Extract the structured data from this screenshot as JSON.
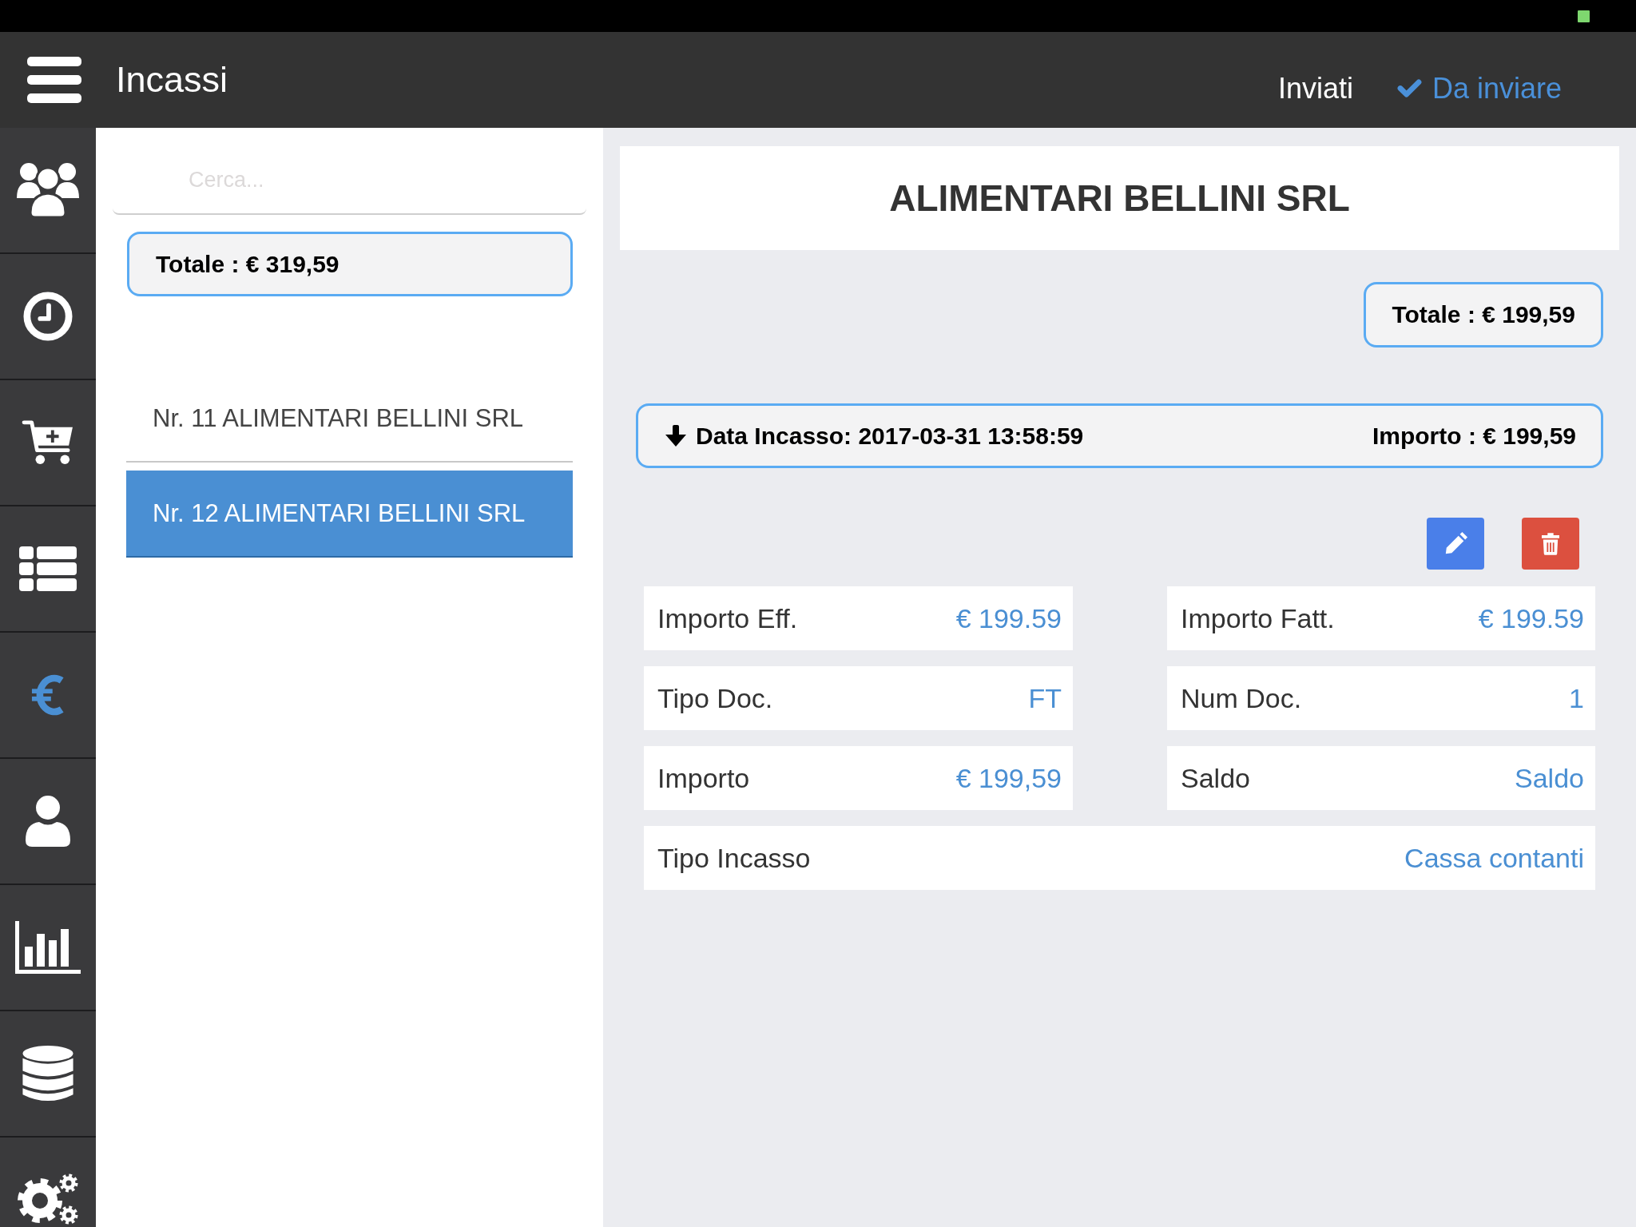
{
  "header": {
    "title": "Incassi",
    "tabs": [
      {
        "label": "Inviati",
        "selected": false
      },
      {
        "label": "Da inviare",
        "selected": true
      }
    ]
  },
  "sidebar": {
    "items": [
      {
        "kind": "users",
        "selected": false
      },
      {
        "kind": "clock",
        "selected": false
      },
      {
        "kind": "cart",
        "selected": false
      },
      {
        "kind": "list",
        "selected": false
      },
      {
        "kind": "euro",
        "selected": true
      },
      {
        "kind": "user",
        "selected": false
      },
      {
        "kind": "chart",
        "selected": false
      },
      {
        "kind": "database",
        "selected": false
      },
      {
        "kind": "gears",
        "selected": false
      }
    ]
  },
  "list_panel": {
    "search": {
      "placeholder": "Cerca..."
    },
    "total": "Totale : € 319,59",
    "items": [
      {
        "label": "Nr. 11 ALIMENTARI BELLINI SRL",
        "selected": false
      },
      {
        "label": "Nr. 12 ALIMENTARI BELLINI SRL",
        "selected": true
      }
    ]
  },
  "detail": {
    "title": "ALIMENTARI BELLINI SRL",
    "total": "Totale : € 199,59",
    "entry": {
      "expanded": true,
      "date": "Data Incasso: 2017-03-31 13:58:59",
      "amount": "Importo : € 199,59"
    },
    "fields": [
      {
        "kind": "half",
        "label": "Importo Eff.",
        "value": "€ 199.59"
      },
      {
        "kind": "half",
        "label": "Importo Fatt.",
        "value": "€ 199.59"
      },
      {
        "kind": "half",
        "label": "Tipo Doc.",
        "value": "FT"
      },
      {
        "kind": "half",
        "label": "Num Doc.",
        "value": "1"
      },
      {
        "kind": "half",
        "label": "Importo",
        "value": "€ 199,59"
      },
      {
        "kind": "half",
        "label": "Saldo",
        "value": "Saldo"
      },
      {
        "kind": "full",
        "label": "Tipo Incasso",
        "value": "Cassa contanti"
      }
    ]
  }
}
